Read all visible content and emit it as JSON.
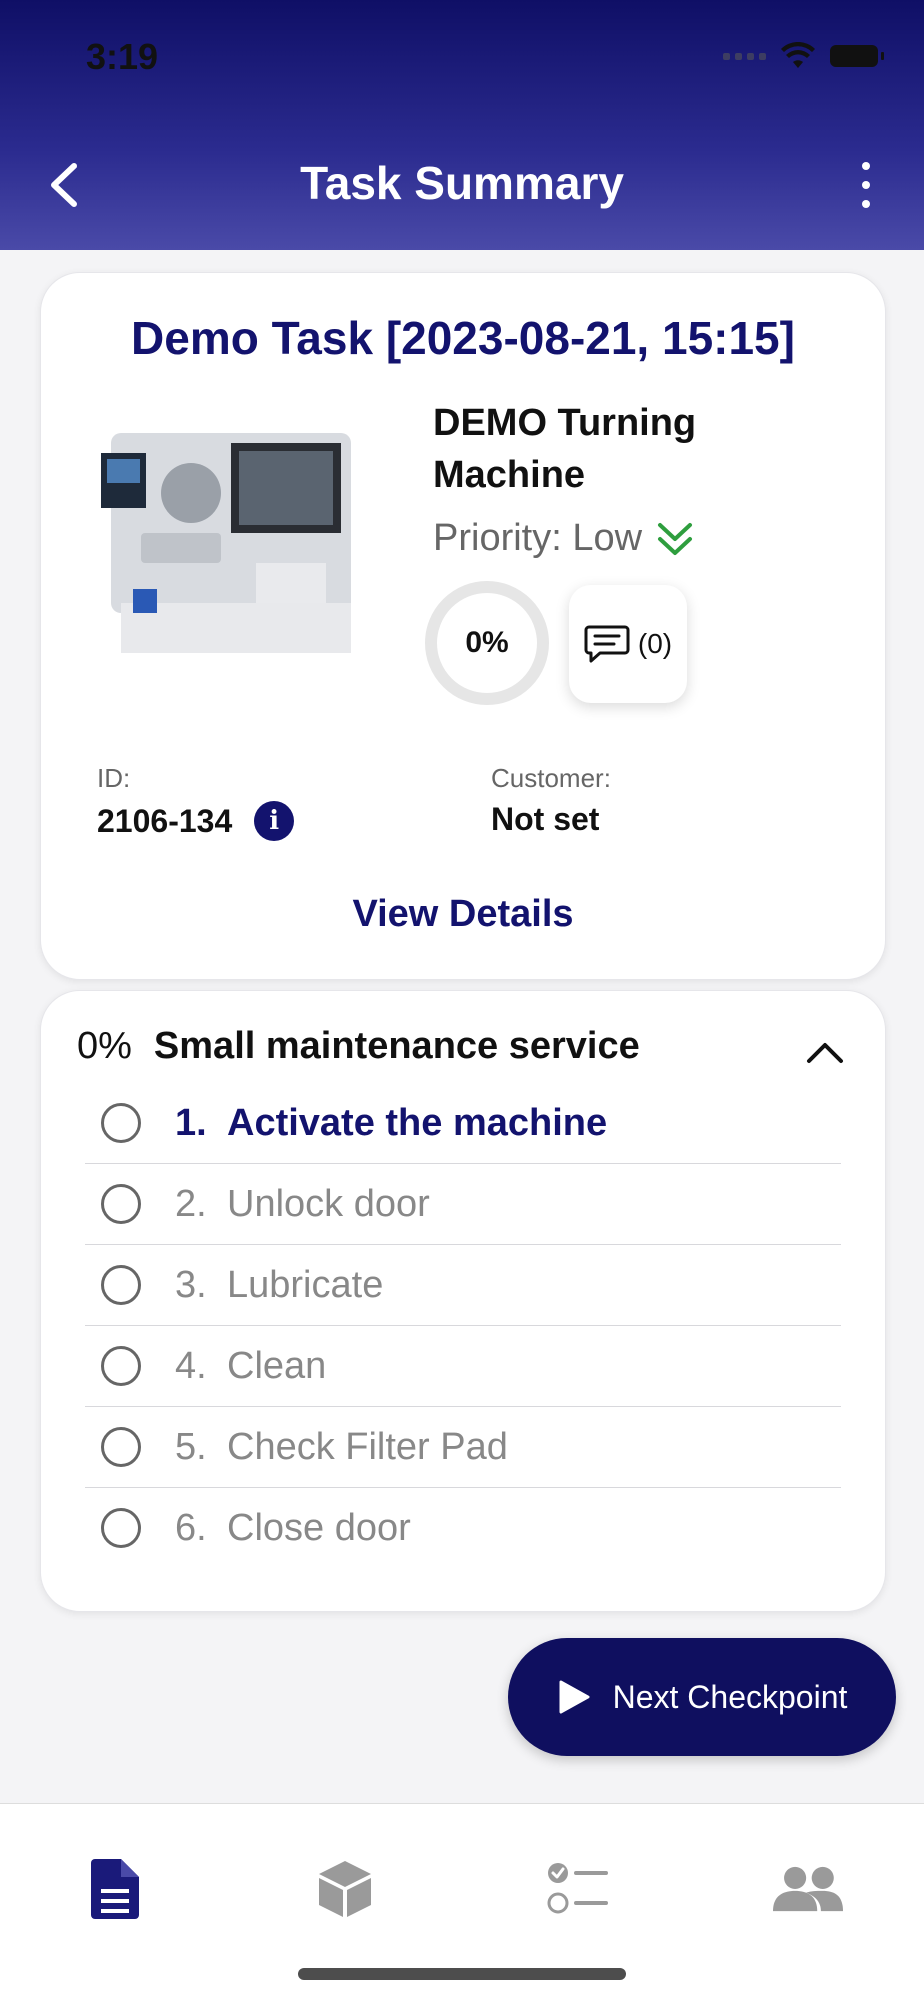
{
  "status": {
    "time": "3:19"
  },
  "nav": {
    "title": "Task Summary"
  },
  "task": {
    "title": "Demo Task [2023-08-21, 15:15]",
    "machine_name": "DEMO Turning Machine",
    "priority": "Priority: Low",
    "progress": "0%",
    "comments": "(0)",
    "id_label": "ID:",
    "id_value": "2106-134",
    "customer_label": "Customer:",
    "customer_value": "Not set",
    "view_details": "View Details"
  },
  "section": {
    "progress": "0%",
    "title": "Small maintenance service",
    "items": [
      {
        "num": "1.",
        "label": "Activate the machine",
        "active": true
      },
      {
        "num": "2.",
        "label": "Unlock door",
        "active": false
      },
      {
        "num": "3.",
        "label": "Lubricate",
        "active": false
      },
      {
        "num": "4.",
        "label": "Clean",
        "active": false
      },
      {
        "num": "5.",
        "label": "Check Filter Pad",
        "active": false
      },
      {
        "num": "6.",
        "label": "Close door",
        "active": false
      }
    ]
  },
  "fab": {
    "label": "Next Checkpoint"
  },
  "tabs": [
    "document-icon",
    "box-icon",
    "checklist-icon",
    "users-icon"
  ],
  "colors": {
    "primary": "#13136e",
    "header_top": "#0f0f66",
    "priority_low": "#2e9e3e"
  }
}
